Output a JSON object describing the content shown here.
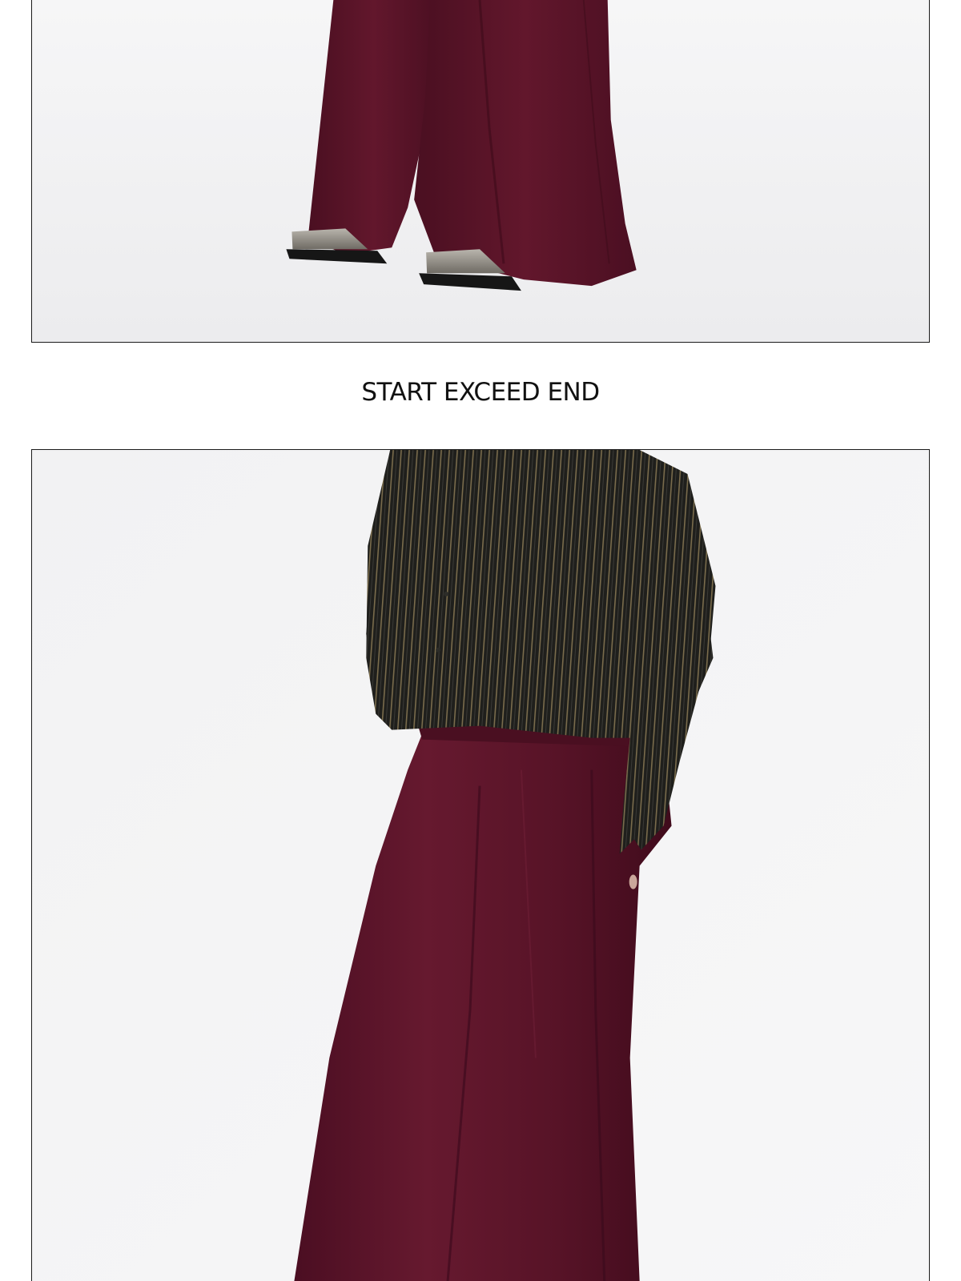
{
  "caption": "START EXCEED END",
  "colors": {
    "trousers": "#5a1327",
    "trousers_shadow": "#3e0b1a",
    "shirt": "#1f1f1c",
    "shirt_stripe": "#7a6c4c",
    "shoe_metal": "#8e8a83",
    "shoe_sole": "#161616",
    "backdrop": "#f4f4f5",
    "frame_border": "#1a1a1a"
  },
  "photos": [
    {
      "name": "trouser-hem-and-shoes-photo"
    },
    {
      "name": "striped-shirt-and-wide-trousers-photo"
    }
  ]
}
